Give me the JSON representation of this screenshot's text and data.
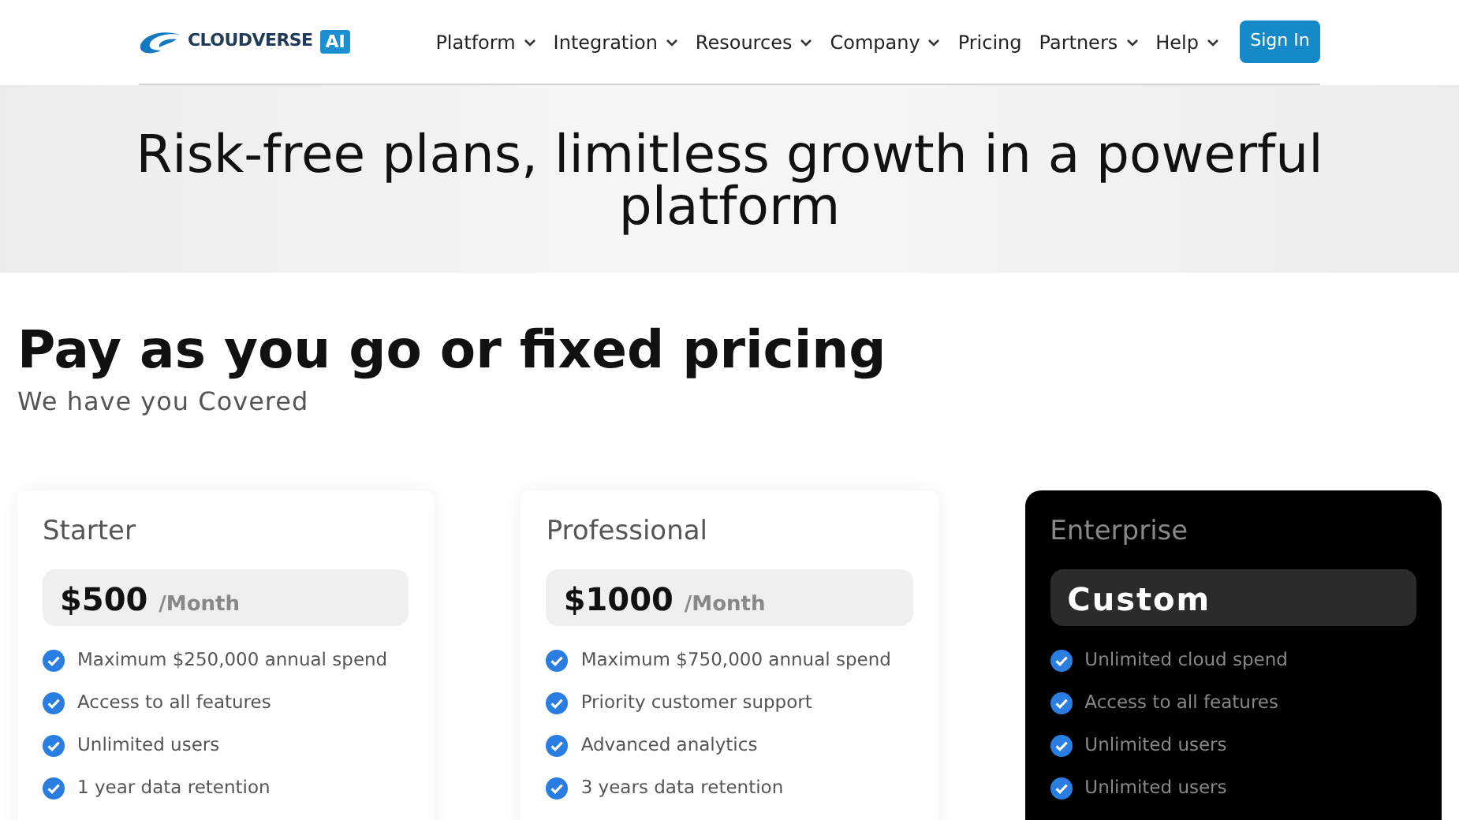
{
  "header": {
    "logo": {
      "name": "CLOUDVERSE",
      "badge": "AI"
    },
    "nav": [
      {
        "label": "Platform",
        "dropdown": true
      },
      {
        "label": "Integration",
        "dropdown": true
      },
      {
        "label": "Resources",
        "dropdown": true
      },
      {
        "label": "Company",
        "dropdown": true
      },
      {
        "label": "Pricing",
        "dropdown": false
      },
      {
        "label": "Partners",
        "dropdown": true
      },
      {
        "label": "Help",
        "dropdown": true
      }
    ],
    "sign_in": "Sign In"
  },
  "hero": {
    "title": "Risk-free plans, limitless growth in a powerful platform"
  },
  "section": {
    "title": "Pay as you go or fixed pricing",
    "subtitle": "We have you Covered"
  },
  "plans": [
    {
      "name": "Starter",
      "kind": "light",
      "price": "$500",
      "period": "/Month",
      "features": [
        "Maximum $250,000 annual spend",
        "Access to all features",
        "Unlimited users",
        "1 year data retention"
      ]
    },
    {
      "name": "Professional",
      "kind": "light",
      "price": "$1000",
      "period": "/Month",
      "features": [
        "Maximum $750,000 annual spend",
        "Priority customer support",
        "Advanced analytics",
        "3 years data retention"
      ]
    },
    {
      "name": "Enterprise",
      "kind": "dark",
      "price": "Custom",
      "features": [
        "Unlimited cloud spend",
        "Access to all features",
        "Unlimited users",
        "Unlimited users"
      ]
    }
  ]
}
